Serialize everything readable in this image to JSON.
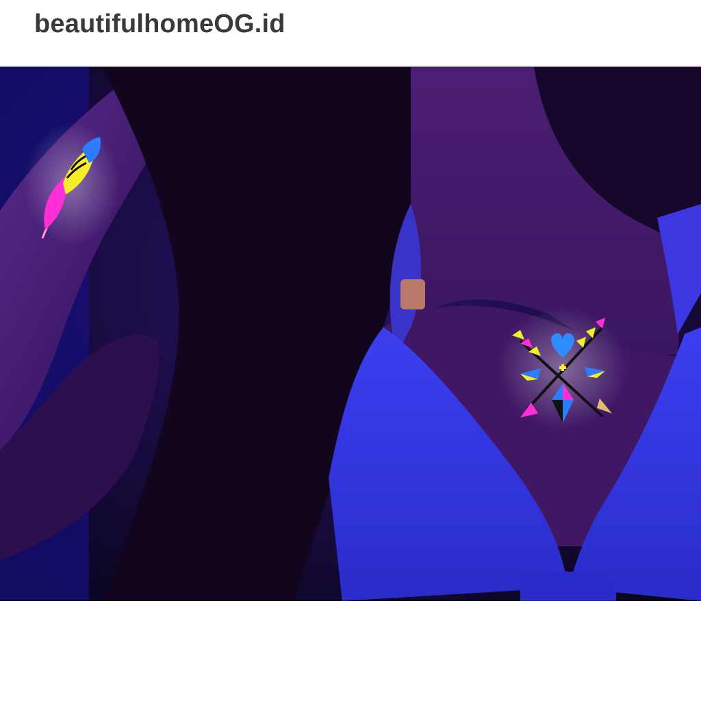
{
  "header": {
    "brand": "beautifulhomeOG.id"
  },
  "photo": {
    "subject": "neon-glow-tattoos-under-uv-light",
    "colors": {
      "background": "#0b0726",
      "uv_blue": "#2b2fd6",
      "skin_uv": "#4a1f7a",
      "hair": "#12061e",
      "neon_pink": "#ff2fd8",
      "neon_yellow": "#f7ee2a",
      "neon_blue": "#2e7cff",
      "gold": "#e9b86a"
    },
    "icons": [
      "feather-tattoo-icon",
      "crossed-arrows-tattoo-icon"
    ]
  }
}
